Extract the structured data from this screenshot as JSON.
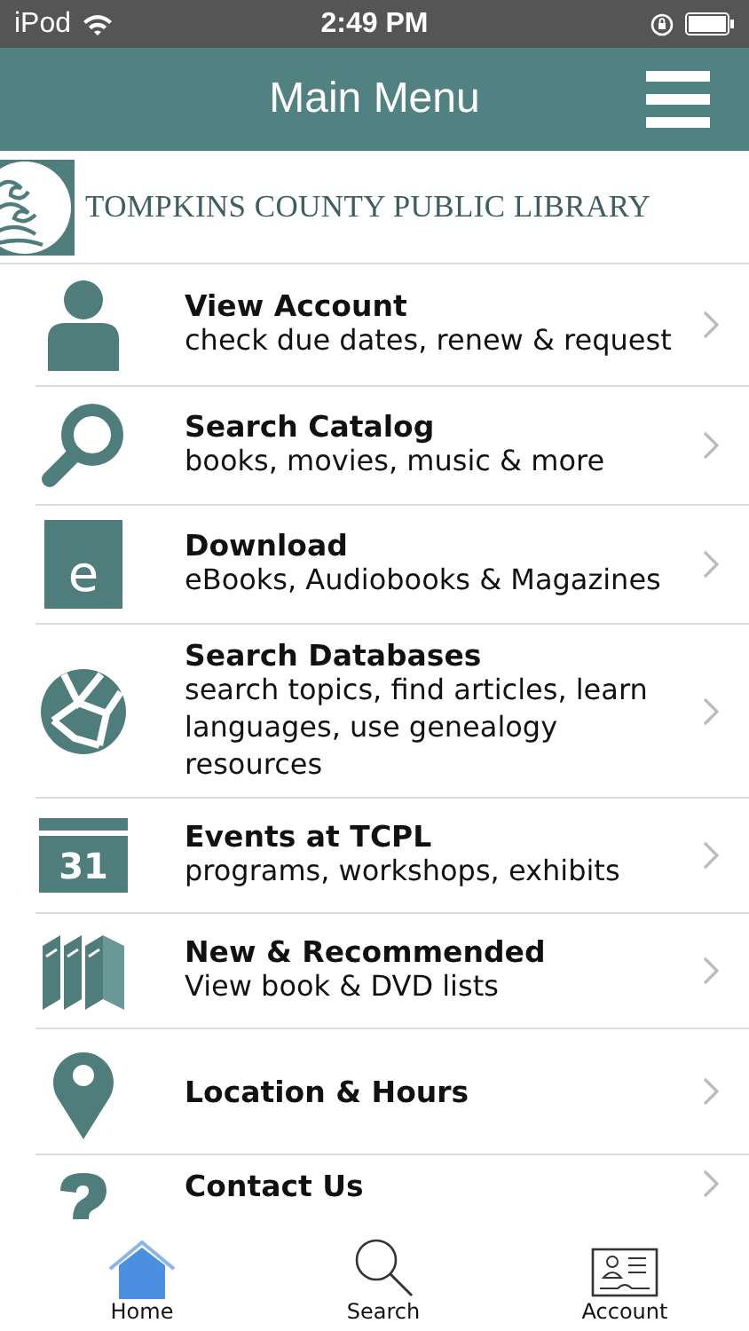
{
  "status_bar": {
    "carrier": "iPod",
    "time": "2:49 PM"
  },
  "header": {
    "title": "Main Menu"
  },
  "logo": {
    "name": "TOMPKINS COUNTY PUBLIC LIBRARY"
  },
  "menu": [
    {
      "kind": "account",
      "title": "View Account",
      "subtitle": "check due dates, renew & request"
    },
    {
      "kind": "search",
      "title": "Search Catalog",
      "subtitle": "books, movies, music & more"
    },
    {
      "kind": "download",
      "icon_text": "e",
      "title": "Download",
      "subtitle": "eBooks, Audiobooks & Magazines"
    },
    {
      "kind": "databases",
      "title": "Search Databases",
      "subtitle": "search topics, find articles, learn languages, use genealogy resources"
    },
    {
      "kind": "events",
      "icon_text": "31",
      "title": "Events at TCPL",
      "subtitle": "programs, workshops, exhibits"
    },
    {
      "kind": "recommended",
      "title": "New & Recommended",
      "subtitle": "View book & DVD lists"
    },
    {
      "kind": "location",
      "title": "Location & Hours"
    },
    {
      "kind": "contact",
      "title": "Contact Us"
    }
  ],
  "tab_bar": [
    {
      "kind": "home",
      "label": "Home",
      "selected": true
    },
    {
      "kind": "search",
      "label": "Search",
      "selected": false
    },
    {
      "kind": "account",
      "label": "Account",
      "selected": false
    }
  ]
}
